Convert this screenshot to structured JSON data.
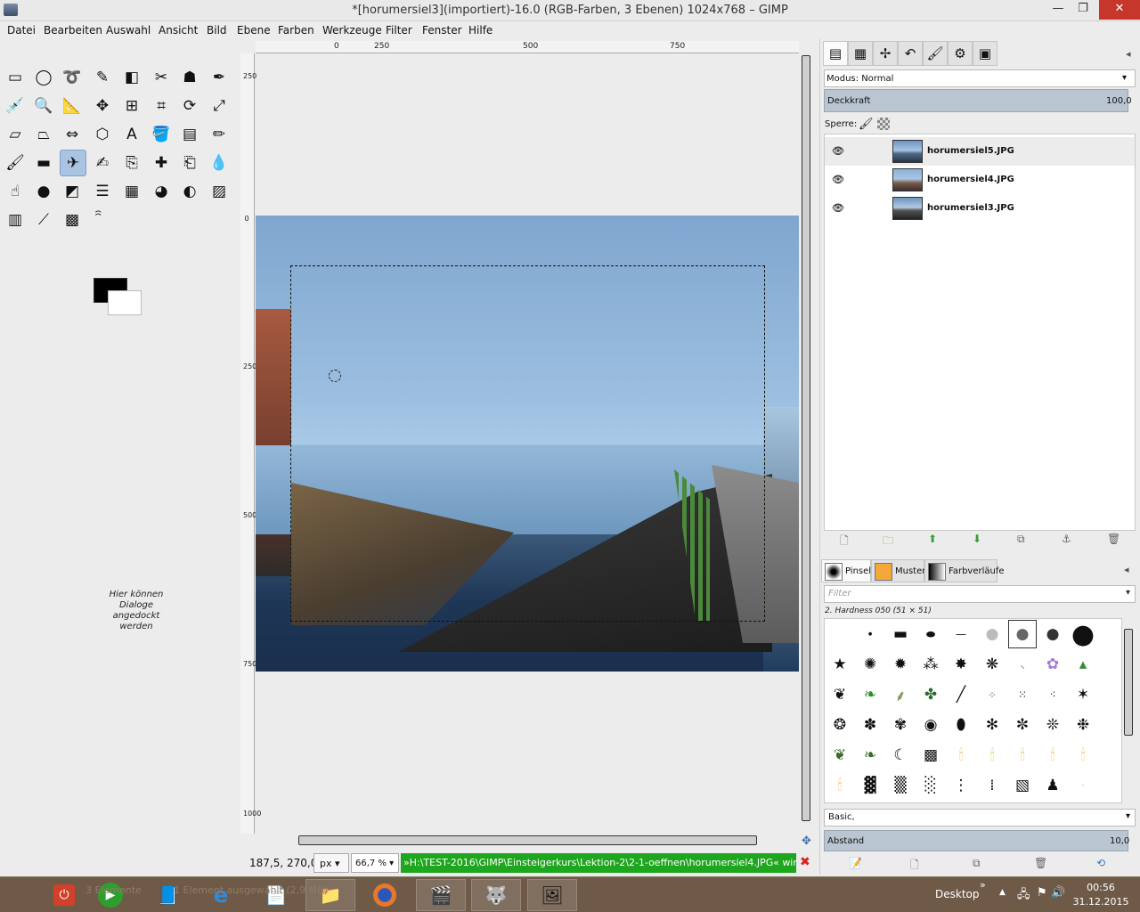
{
  "window": {
    "title": "*[horumersiel3](importiert)-16.0 (RGB-Farben, 3 Ebenen) 1024x768 – GIMP",
    "minimize": "—",
    "restore": "❐",
    "close": "✕"
  },
  "menu": [
    "Datei",
    "Bearbeiten",
    "Auswahl",
    "Ansicht",
    "Bild",
    "Ebene",
    "Farben",
    "Werkzeuge",
    "Filter",
    "Fenster",
    "Hilfe"
  ],
  "toolbox": {
    "dock_hint": "Hier können Dialoge angedockt werden",
    "fg_color": "#000000",
    "bg_color": "#ffffff"
  },
  "rulers": {
    "h_labels": [
      "0",
      "250",
      "500",
      "750"
    ],
    "v_labels": [
      "250",
      "0",
      "250",
      "500",
      "750",
      "1000"
    ]
  },
  "status": {
    "coords": "187,5, 270,0",
    "unit": "px",
    "zoom": "66,7 %",
    "message": "»H:\\TEST-2016\\GIMP\\Einsteigerkurs\\Lektion-2\\2-1-oeffnen\\horumersiel4.JPG« wir...",
    "message_color": "#1ea61e"
  },
  "layers_panel": {
    "mode_label": "Modus: Normal",
    "opacity_label": "Deckkraft",
    "opacity_value": "100,0",
    "lock_label": "Sperre:",
    "layers": [
      {
        "name": "horumersiel5.JPG",
        "visible": true,
        "selected": true
      },
      {
        "name": "horumersiel4.JPG",
        "visible": true,
        "selected": false
      },
      {
        "name": "horumersiel3.JPG",
        "visible": true,
        "selected": false
      }
    ]
  },
  "brushes_panel": {
    "tabs": [
      "Pinsel",
      "Muster",
      "Farbverläufe"
    ],
    "filter_placeholder": "Filter",
    "selected_brush": "2. Hardness 050 (51 × 51)",
    "preset": "Basic,",
    "spacing_label": "Abstand",
    "spacing_value": "10,0"
  },
  "taskbar": {
    "desktop_label": "Desktop",
    "chevron": "»",
    "time": "00:56",
    "date": "31.12.2015",
    "ghost_1": "3 Elemente",
    "ghost_2": "1 Element ausgewählt (2,9 MB)"
  }
}
